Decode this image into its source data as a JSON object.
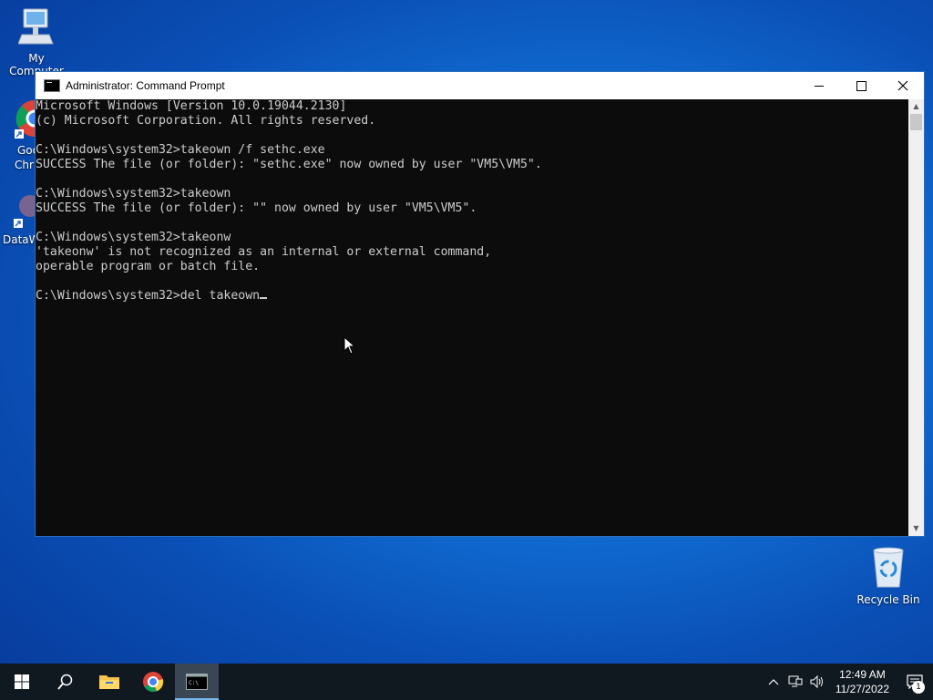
{
  "desktop": {
    "icons": [
      {
        "label": "My Computer"
      },
      {
        "label": "Goo"
      },
      {
        "label": "Chr"
      },
      {
        "label": "DataW"
      },
      {
        "label": "Recycle Bin"
      }
    ]
  },
  "window": {
    "title": "Administrator: Command Prompt",
    "controls": {
      "minimize": "minimize",
      "maximize": "maximize",
      "close": "close"
    },
    "console_lines": [
      "Microsoft Windows [Version 10.0.19044.2130]",
      "(c) Microsoft Corporation. All rights reserved.",
      "",
      "C:\\Windows\\system32>takeown /f sethc.exe",
      "SUCCESS The file (or folder): \"sethc.exe\" now owned by user \"VM5\\VM5\".",
      "",
      "C:\\Windows\\system32>takeown",
      "SUCCESS The file (or folder): \"\" now owned by user \"VM5\\VM5\".",
      "",
      "C:\\Windows\\system32>takeonw",
      "'takeonw' is not recognized as an internal or external command,",
      "operable program or batch file.",
      "",
      "C:\\Windows\\system32>del takeown"
    ]
  },
  "taskbar": {
    "apps": [
      {
        "name": "start-icon"
      },
      {
        "name": "search-icon"
      },
      {
        "name": "file-explorer-icon"
      },
      {
        "name": "chrome-icon"
      },
      {
        "name": "command-prompt-icon",
        "active": true
      }
    ],
    "clock": {
      "time": "12:49 AM",
      "date": "11/27/2022"
    },
    "notification_count": "1"
  }
}
